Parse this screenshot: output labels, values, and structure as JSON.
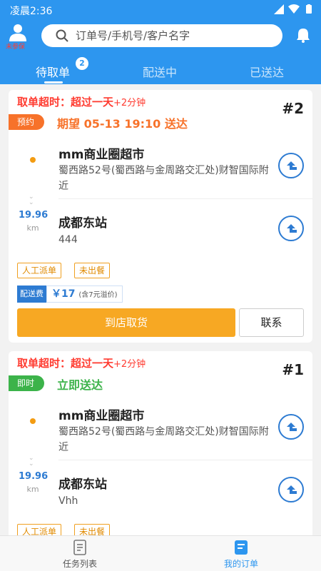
{
  "status_bar": {
    "time": "凌晨2:36"
  },
  "header": {
    "avatar_label": "未参保",
    "search_placeholder": "订单号/手机号/客户名字"
  },
  "tabs": [
    {
      "label": "待取单",
      "badge": "2",
      "active": true
    },
    {
      "label": "配送中",
      "active": false
    },
    {
      "label": "已送达",
      "active": false
    }
  ],
  "orders": [
    {
      "timeout_text": "取单超时：超过一天",
      "timeout_extra": "+2分钟",
      "order_no": "#2",
      "type_label": "预约",
      "type_color": "#f7722a",
      "expect_text": "期望 05-13 19:10 送达",
      "expect_color": "#f7722a",
      "shop_name": "mm商业圈超市",
      "shop_address": "蜀西路52号(蜀西路与金周路交汇处)财智国际附近",
      "distance": "19.96",
      "distance_unit": "km",
      "dest_name": "成都东站",
      "dest_note": "444",
      "tags": [
        "人工派单",
        "未出餐"
      ],
      "fee_label": "配送费",
      "fee_value": "￥17",
      "fee_note": "(含7元溢价)",
      "primary_action": "到店取货",
      "secondary_action": "联系"
    },
    {
      "timeout_text": "取单超时：超过一天",
      "timeout_extra": "+2分钟",
      "order_no": "#1",
      "type_label": "即时",
      "type_color": "#3cb34a",
      "expect_text": "立即送达",
      "expect_color": "#3cb34a",
      "shop_name": "mm商业圈超市",
      "shop_address": "蜀西路52号(蜀西路与金周路交汇处)财智国际附近",
      "distance": "19.96",
      "distance_unit": "km",
      "dest_name": "成都东站",
      "dest_note": "Vhh",
      "tags": [
        "人工派单",
        "未出餐"
      ]
    }
  ],
  "bottom_nav": [
    {
      "label": "任务列表",
      "active": false
    },
    {
      "label": "我的订单",
      "active": true
    }
  ],
  "colors": {
    "primary": "#2d96ef",
    "accent": "#f7a823",
    "alert": "#ff3b30"
  }
}
